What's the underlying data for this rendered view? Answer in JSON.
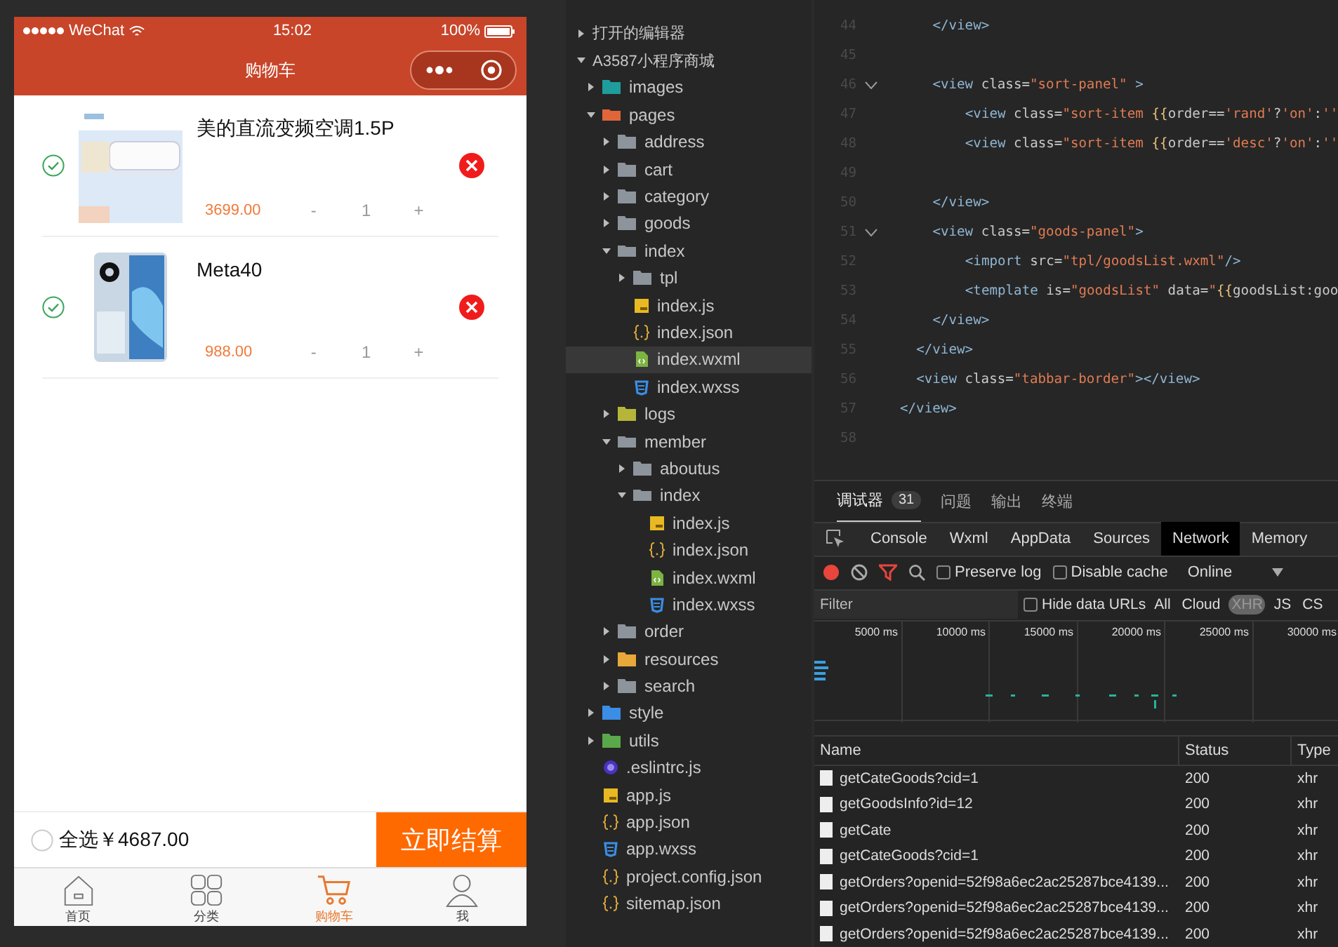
{
  "phone": {
    "status_bar": {
      "carrier": "WeChat",
      "time": "15:02",
      "battery": "100%"
    },
    "nav_title": "购物车",
    "cart_items": [
      {
        "name": "美的直流变频空调1.5P",
        "price": "3699.00",
        "quantity": "1",
        "minus": "-",
        "plus": "+",
        "checked": true
      },
      {
        "name": "Meta40",
        "price": "988.00",
        "quantity": "1",
        "minus": "-",
        "plus": "+",
        "checked": true
      }
    ],
    "footer": {
      "select_all": {
        "label": "全选",
        "checked": false
      },
      "total": "￥4687.00",
      "checkout": "立即结算"
    },
    "tabbar": [
      {
        "label": "首页",
        "selected": false
      },
      {
        "label": "分类",
        "selected": false
      },
      {
        "label": "购物车",
        "selected": true
      },
      {
        "label": "我",
        "selected": false
      }
    ]
  },
  "explorer": {
    "sections": [
      {
        "label": "打开的编辑器",
        "expanded": false,
        "selected": false
      },
      {
        "label": "A3587小程序商城",
        "expanded": true,
        "selected": false,
        "children": [
          {
            "label": "images",
            "kind": "folder",
            "color": "#1f9c9c",
            "expanded": false,
            "selected": false
          },
          {
            "label": "pages",
            "kind": "folder",
            "color": "#e0663a",
            "expanded": true,
            "selected": false,
            "children": [
              {
                "label": "address",
                "kind": "folder",
                "color": "#8d949c",
                "expanded": false,
                "selected": false
              },
              {
                "label": "cart",
                "kind": "folder",
                "color": "#8d949c",
                "expanded": false,
                "selected": false
              },
              {
                "label": "category",
                "kind": "folder",
                "color": "#8d949c",
                "expanded": false,
                "selected": false
              },
              {
                "label": "goods",
                "kind": "folder",
                "color": "#8d949c",
                "expanded": false,
                "selected": false
              },
              {
                "label": "index",
                "kind": "folder",
                "color": "#8d949c",
                "expanded": true,
                "selected": false,
                "children": [
                  {
                    "label": "tpl",
                    "kind": "folder",
                    "color": "#8d949c",
                    "expanded": false,
                    "selected": false
                  },
                  {
                    "label": "index.js",
                    "kind": "js",
                    "selected": false
                  },
                  {
                    "label": "index.json",
                    "kind": "json",
                    "selected": false
                  },
                  {
                    "label": "index.wxml",
                    "kind": "wxml",
                    "selected": true
                  },
                  {
                    "label": "index.wxss",
                    "kind": "wxss",
                    "selected": false
                  }
                ]
              },
              {
                "label": "logs",
                "kind": "folder",
                "color": "#b5b53a",
                "expanded": false,
                "selected": false
              },
              {
                "label": "member",
                "kind": "folder",
                "color": "#8d949c",
                "expanded": true,
                "selected": false,
                "children": [
                  {
                    "label": "aboutus",
                    "kind": "folder",
                    "color": "#8d949c",
                    "expanded": false,
                    "selected": false
                  },
                  {
                    "label": "index",
                    "kind": "folder",
                    "color": "#8d949c",
                    "expanded": true,
                    "selected": false,
                    "children": [
                      {
                        "label": "index.js",
                        "kind": "js",
                        "selected": false
                      },
                      {
                        "label": "index.json",
                        "kind": "json",
                        "selected": false
                      },
                      {
                        "label": "index.wxml",
                        "kind": "wxml",
                        "selected": false
                      },
                      {
                        "label": "index.wxss",
                        "kind": "wxss",
                        "selected": false
                      }
                    ]
                  }
                ]
              },
              {
                "label": "order",
                "kind": "folder",
                "color": "#8d949c",
                "expanded": false,
                "selected": false
              },
              {
                "label": "resources",
                "kind": "folder",
                "color": "#e8a83a",
                "expanded": false,
                "selected": false
              },
              {
                "label": "search",
                "kind": "folder",
                "color": "#8d949c",
                "expanded": false,
                "selected": false
              }
            ]
          },
          {
            "label": "style",
            "kind": "folder",
            "color": "#3a8ee6",
            "expanded": false,
            "selected": false
          },
          {
            "label": "utils",
            "kind": "folder",
            "color": "#5aa84a",
            "expanded": false,
            "selected": false
          },
          {
            "label": ".eslintrc.js",
            "kind": "eslint",
            "selected": false
          },
          {
            "label": "app.js",
            "kind": "js",
            "selected": false
          },
          {
            "label": "app.json",
            "kind": "json",
            "selected": false
          },
          {
            "label": "app.wxss",
            "kind": "wxss",
            "selected": false
          },
          {
            "label": "project.config.json",
            "kind": "json",
            "selected": false
          },
          {
            "label": "sitemap.json",
            "kind": "json",
            "selected": false
          }
        ]
      }
    ]
  },
  "editor": {
    "lines": [
      {
        "number": "44",
        "foldable": false,
        "segments": [
          {
            "kind": "tag",
            "text": "</view>"
          }
        ]
      },
      {
        "number": "45",
        "foldable": false
      },
      {
        "number": "46",
        "foldable": true,
        "segments": [
          {
            "kind": "tag",
            "text": "<view "
          },
          {
            "kind": "attr",
            "text": "class="
          },
          {
            "kind": "string",
            "text": "\"sort-panel\""
          },
          {
            "kind": "tag",
            "text": " >"
          }
        ]
      },
      {
        "number": "47",
        "foldable": false,
        "segments": [
          {
            "kind": "tag",
            "text": "<view "
          },
          {
            "kind": "attr",
            "text": "class="
          },
          {
            "kind": "string",
            "text": "\"sort-item "
          },
          {
            "kind": "brace",
            "text": "{{"
          },
          {
            "kind": "attr",
            "text": "order=="
          },
          {
            "kind": "string",
            "text": "'rand'"
          },
          {
            "kind": "attr",
            "text": "?"
          },
          {
            "kind": "string",
            "text": "'on'"
          },
          {
            "kind": "attr",
            "text": ":"
          },
          {
            "kind": "string",
            "text": "''"
          }
        ]
      },
      {
        "number": "48",
        "foldable": false,
        "segments": [
          {
            "kind": "tag",
            "text": "<view "
          },
          {
            "kind": "attr",
            "text": "class="
          },
          {
            "kind": "string",
            "text": "\"sort-item "
          },
          {
            "kind": "brace",
            "text": "{{"
          },
          {
            "kind": "attr",
            "text": "order=="
          },
          {
            "kind": "string",
            "text": "'desc'"
          },
          {
            "kind": "attr",
            "text": "?"
          },
          {
            "kind": "string",
            "text": "'on'"
          },
          {
            "kind": "attr",
            "text": ":"
          },
          {
            "kind": "string",
            "text": "''"
          }
        ]
      },
      {
        "number": "49",
        "foldable": false
      },
      {
        "number": "50",
        "foldable": false,
        "segments": [
          {
            "kind": "tag",
            "text": "</view>"
          }
        ]
      },
      {
        "number": "51",
        "foldable": true,
        "segments": [
          {
            "kind": "tag",
            "text": "<view "
          },
          {
            "kind": "attr",
            "text": "class="
          },
          {
            "kind": "string",
            "text": "\"goods-panel\""
          },
          {
            "kind": "tag",
            "text": ">"
          }
        ]
      },
      {
        "number": "52",
        "foldable": false,
        "segments": [
          {
            "kind": "tag",
            "text": "<import "
          },
          {
            "kind": "attr",
            "text": "src="
          },
          {
            "kind": "string",
            "text": "\"tpl/goodsList.wxml\""
          },
          {
            "kind": "tag",
            "text": "/>"
          }
        ]
      },
      {
        "number": "53",
        "foldable": false,
        "segments": [
          {
            "kind": "tag",
            "text": "<template "
          },
          {
            "kind": "attr",
            "text": "is="
          },
          {
            "kind": "string",
            "text": "\"goodsList\""
          },
          {
            "kind": "attr",
            "text": " data="
          },
          {
            "kind": "string",
            "text": "\""
          },
          {
            "kind": "brace",
            "text": "{{"
          },
          {
            "kind": "attr",
            "text": "goodsList:goo"
          }
        ]
      },
      {
        "number": "54",
        "foldable": false,
        "segments": [
          {
            "kind": "tag",
            "text": "</view>"
          }
        ]
      },
      {
        "number": "55",
        "foldable": false,
        "segments": [
          {
            "kind": "tag",
            "text": "</view>"
          }
        ]
      },
      {
        "number": "56",
        "foldable": false,
        "segments": [
          {
            "kind": "tag",
            "text": "<view "
          },
          {
            "kind": "attr",
            "text": "class="
          },
          {
            "kind": "string",
            "text": "\"tabbar-border\""
          },
          {
            "kind": "tag",
            "text": "></view>"
          }
        ]
      },
      {
        "number": "57",
        "foldable": false,
        "segments": [
          {
            "kind": "tag",
            "text": "</view>"
          }
        ]
      },
      {
        "number": "58",
        "foldable": false
      }
    ]
  },
  "devtools": {
    "top_tabs": [
      {
        "label": "调试器",
        "badge": "31",
        "selected": true
      },
      {
        "label": "问题",
        "selected": false
      },
      {
        "label": "输出",
        "selected": false
      },
      {
        "label": "终端",
        "selected": false
      }
    ],
    "panel_tabs": [
      {
        "label": "Console",
        "selected": false
      },
      {
        "label": "Wxml",
        "selected": false
      },
      {
        "label": "AppData",
        "selected": false
      },
      {
        "label": "Sources",
        "selected": false
      },
      {
        "label": "Network",
        "selected": true
      },
      {
        "label": "Memory",
        "selected": false
      }
    ],
    "toolbar": {
      "preserve_log": {
        "label": "Preserve log",
        "checked": false
      },
      "disable_cache": {
        "label": "Disable cache",
        "checked": false
      },
      "throttling": "Online"
    },
    "filter": {
      "placeholder": "Filter",
      "hide_data_urls": {
        "label": "Hide data URLs",
        "checked": false
      },
      "types": [
        {
          "label": "All",
          "selected": false
        },
        {
          "label": "Cloud",
          "selected": false
        },
        {
          "label": "XHR",
          "selected": true
        },
        {
          "label": "JS",
          "selected": false
        },
        {
          "label": "CS",
          "selected": false
        }
      ]
    },
    "timeline_ticks": [
      "5000 ms",
      "10000 ms",
      "15000 ms",
      "20000 ms",
      "25000 ms",
      "30000 ms"
    ],
    "table": {
      "columns": [
        "Name",
        "Status",
        "Type"
      ],
      "rows": [
        {
          "name": "getCateGoods?cid=1",
          "status": "200",
          "type": "xhr"
        },
        {
          "name": "getGoodsInfo?id=12",
          "status": "200",
          "type": "xhr"
        },
        {
          "name": "getCate",
          "status": "200",
          "type": "xhr"
        },
        {
          "name": "getCateGoods?cid=1",
          "status": "200",
          "type": "xhr"
        },
        {
          "name": "getOrders?openid=52f98a6ec2ac25287bce4139...",
          "status": "200",
          "type": "xhr"
        },
        {
          "name": "getOrders?openid=52f98a6ec2ac25287bce4139...",
          "status": "200",
          "type": "xhr"
        },
        {
          "name": "getOrders?openid=52f98a6ec2ac25287bce4139...",
          "status": "200",
          "type": "xhr"
        }
      ]
    }
  }
}
